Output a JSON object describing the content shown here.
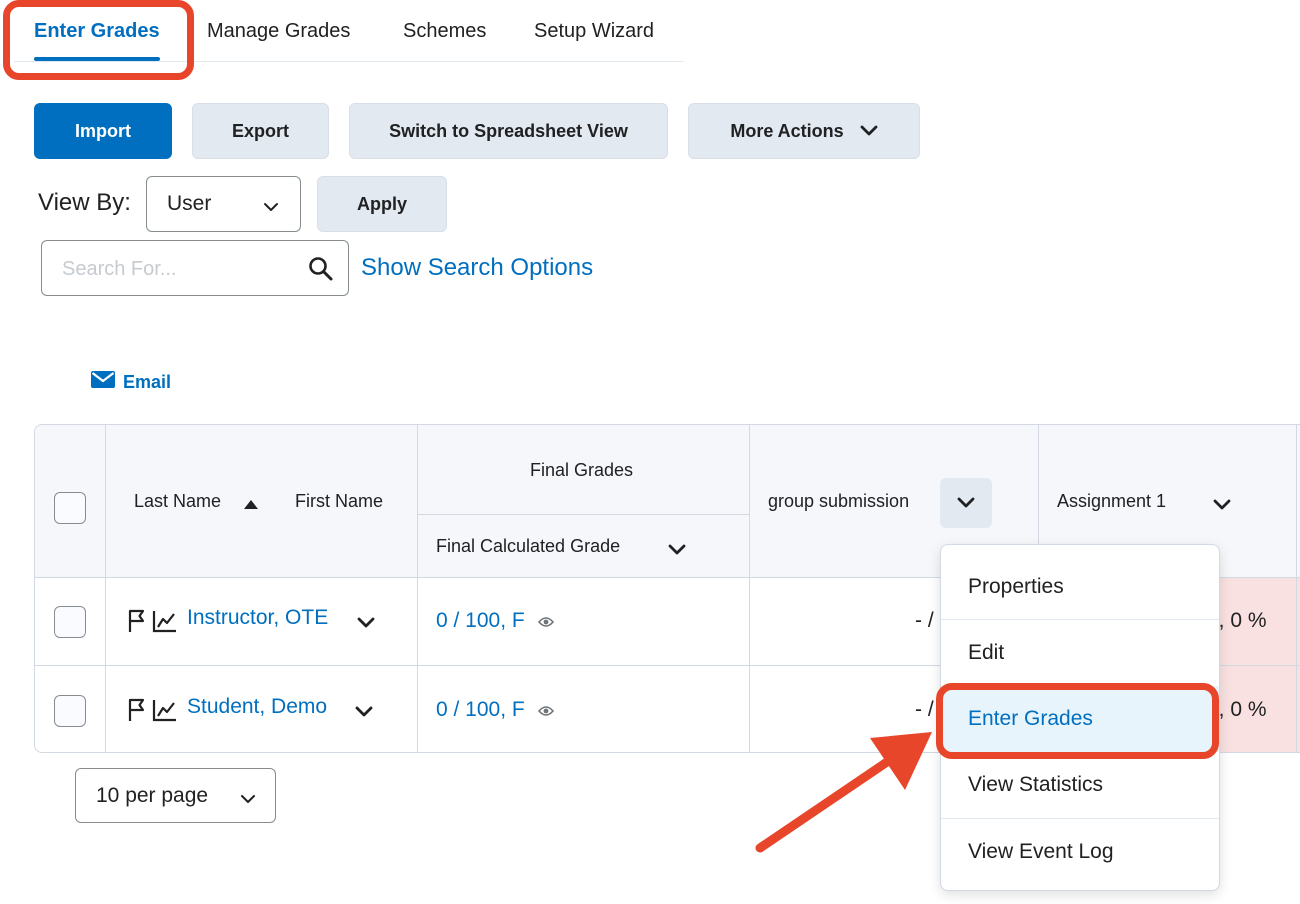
{
  "tabs": {
    "enter_grades": "Enter Grades",
    "manage_grades": "Manage Grades",
    "schemes": "Schemes",
    "setup_wizard": "Setup Wizard"
  },
  "toolbar": {
    "import": "Import",
    "export": "Export",
    "spreadsheet": "Switch to Spreadsheet View",
    "more_actions": "More Actions"
  },
  "view_by": {
    "label": "View By:",
    "value": "User",
    "apply": "Apply"
  },
  "search": {
    "placeholder": "Search For...",
    "options_link": "Show Search Options"
  },
  "email_label": "Email",
  "grid": {
    "headers": {
      "last_name": "Last Name",
      "first_name": "First Name",
      "final_grades": "Final Grades",
      "final_calculated": "Final Calculated Grade",
      "group_submission": "group submission",
      "assignment1": "Assignment 1"
    },
    "rows": [
      {
        "name": "Instructor, OTE",
        "final": "0 / 100, F",
        "group": "- /",
        "assignment": "0, 0 %"
      },
      {
        "name": "Student, Demo",
        "final": "0 / 100, F",
        "group": "- /",
        "assignment": "0, 0 %"
      }
    ]
  },
  "pager": {
    "value": "10 per page"
  },
  "menu": {
    "items": [
      "Properties",
      "Edit",
      "Enter Grades",
      "View Statistics",
      "View Event Log"
    ]
  },
  "colors": {
    "accent": "#006fbf",
    "highlight": "#e8462a",
    "danger_bg": "#f9e1e1"
  }
}
